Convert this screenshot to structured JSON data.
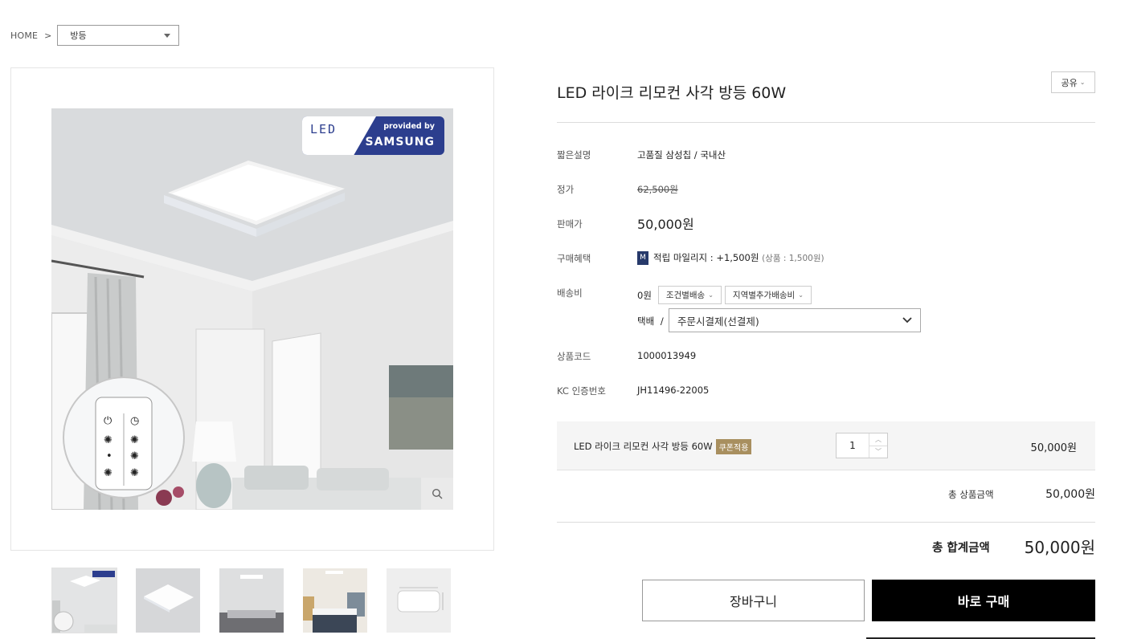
{
  "breadcrumb": {
    "home": "HOME",
    "separator": ">",
    "category": "방등"
  },
  "product": {
    "title": "LED 라이크 리모컨 사각 방등 60W",
    "share_label": "공유",
    "fields": {
      "short_desc_label": "짧은설명",
      "short_desc": "고품질 삼성칩 / 국내산",
      "list_price_label": "정가",
      "list_price": "62,500원",
      "sale_price_label": "판매가",
      "sale_price": "50,000원",
      "benefit_label": "구매혜택",
      "mileage_badge": "M",
      "mileage_text": "적립 마일리지 : +1,500원",
      "mileage_sub": "(상품 : 1,500원)",
      "shipping_label": "배송비",
      "shipping_fee": "0원",
      "shipping_btn1": "조건별배송",
      "shipping_btn2": "지역별추가배송비",
      "courier": "택배",
      "courier_sep": "/",
      "payment_option": "주문시결제(선결제)",
      "code_label": "상품코드",
      "code": "1000013949",
      "kc_label": "KC 인증번호",
      "kc": "JH11496-22005"
    },
    "option": {
      "name": "LED 라이크 리모컨 사각 방등 60W",
      "coupon": "쿠폰적용",
      "quantity": "1",
      "price": "50,000원"
    },
    "totals": {
      "sub_label": "총 상품금액",
      "sub_value": "50,000원",
      "grand_label": "총 합계금액",
      "grand_value": "50,000원"
    },
    "buttons": {
      "cart": "장바구니",
      "buy": "바로 구매"
    }
  },
  "image": {
    "led_logo": "LED",
    "provided_by": "provided by",
    "brand": "SAMSUNG"
  },
  "colors": {
    "badge_blue": "#273a6b",
    "coupon_gold": "#a88f5f",
    "buy_bg": "#000000"
  }
}
